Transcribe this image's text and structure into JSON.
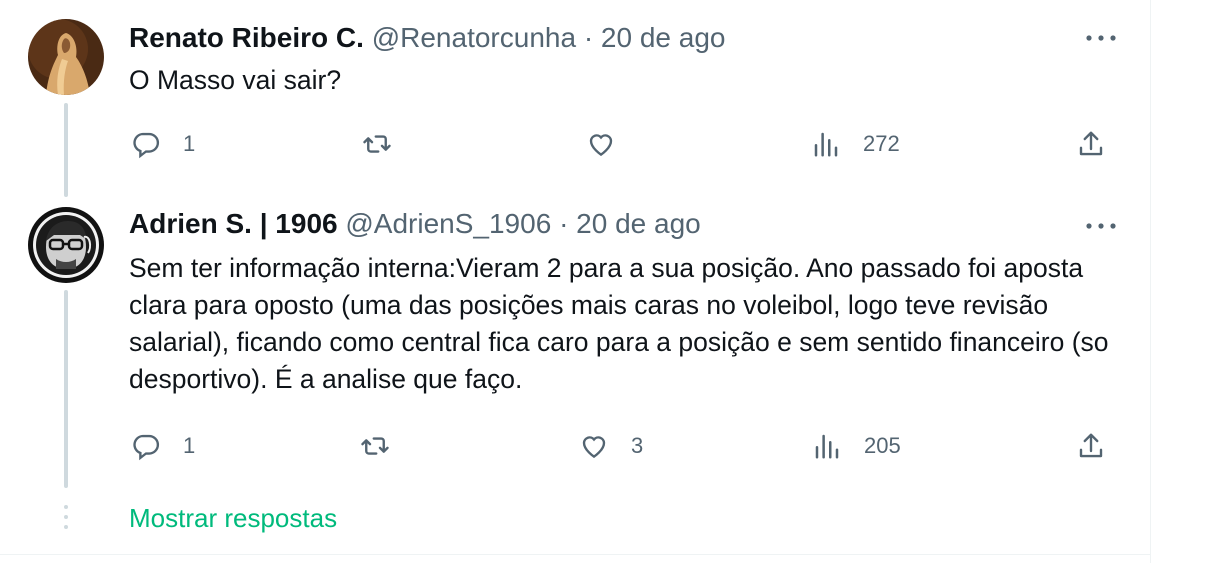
{
  "tweets": [
    {
      "name": "Renato Ribeiro C.",
      "handle": "@Renatorcunha",
      "separator": "·",
      "date": "20 de ago",
      "text": "O Masso vai sair?",
      "replies": "1",
      "retweets": "",
      "likes": "",
      "views": "272"
    },
    {
      "name": "Adrien S. | 1906",
      "handle": "@AdrienS_1906",
      "separator": "·",
      "date": "20 de ago",
      "text": "Sem ter informação interna:Vieram 2 para a sua posição. Ano passado foi aposta clara para oposto (uma das posições mais caras no voleibol, logo teve revisão salarial), ficando como central fica caro para a posição e sem sentido financeiro (so desportivo). É a analise que faço.",
      "replies": "1",
      "retweets": "",
      "likes": "3",
      "views": "205"
    }
  ],
  "show_replies_label": "Mostrar respostas",
  "colors": {
    "text": "#0f1419",
    "secondary": "#536471",
    "accent_green": "#00ba7c",
    "thread_line": "#cfd9de"
  }
}
